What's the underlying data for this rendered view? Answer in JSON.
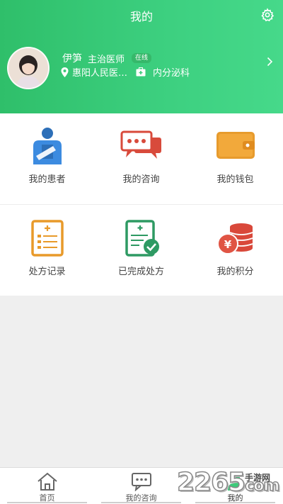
{
  "header": {
    "title": "我的",
    "settings_icon": "gear-icon",
    "accent": "#3dcb7a"
  },
  "profile": {
    "name": "伊笋",
    "title": "主治医师",
    "status": "在线",
    "hospital": "惠阳人民医…",
    "department": "内分泌科",
    "location_icon": "location-pin-icon",
    "dept_icon": "medical-kit-icon"
  },
  "grid": {
    "row1": [
      {
        "label": "我的患者",
        "icon": "patient-icon"
      },
      {
        "label": "我的咨询",
        "icon": "chat-bubbles-icon"
      },
      {
        "label": "我的钱包",
        "icon": "wallet-icon"
      }
    ],
    "row2": [
      {
        "label": "处方记录",
        "icon": "prescription-record-icon"
      },
      {
        "label": "已完成处方",
        "icon": "completed-prescription-icon"
      },
      {
        "label": "我的积分",
        "icon": "coins-icon"
      }
    ]
  },
  "tabbar": {
    "tabs": [
      {
        "label": "首页",
        "icon": "home-icon"
      },
      {
        "label": "我的咨询",
        "icon": "chat-icon"
      },
      {
        "label": "我的",
        "icon": "person-icon"
      }
    ],
    "active": "我的"
  },
  "watermark": {
    "text": "2265",
    "suffix": "com",
    "site": "手游网"
  }
}
